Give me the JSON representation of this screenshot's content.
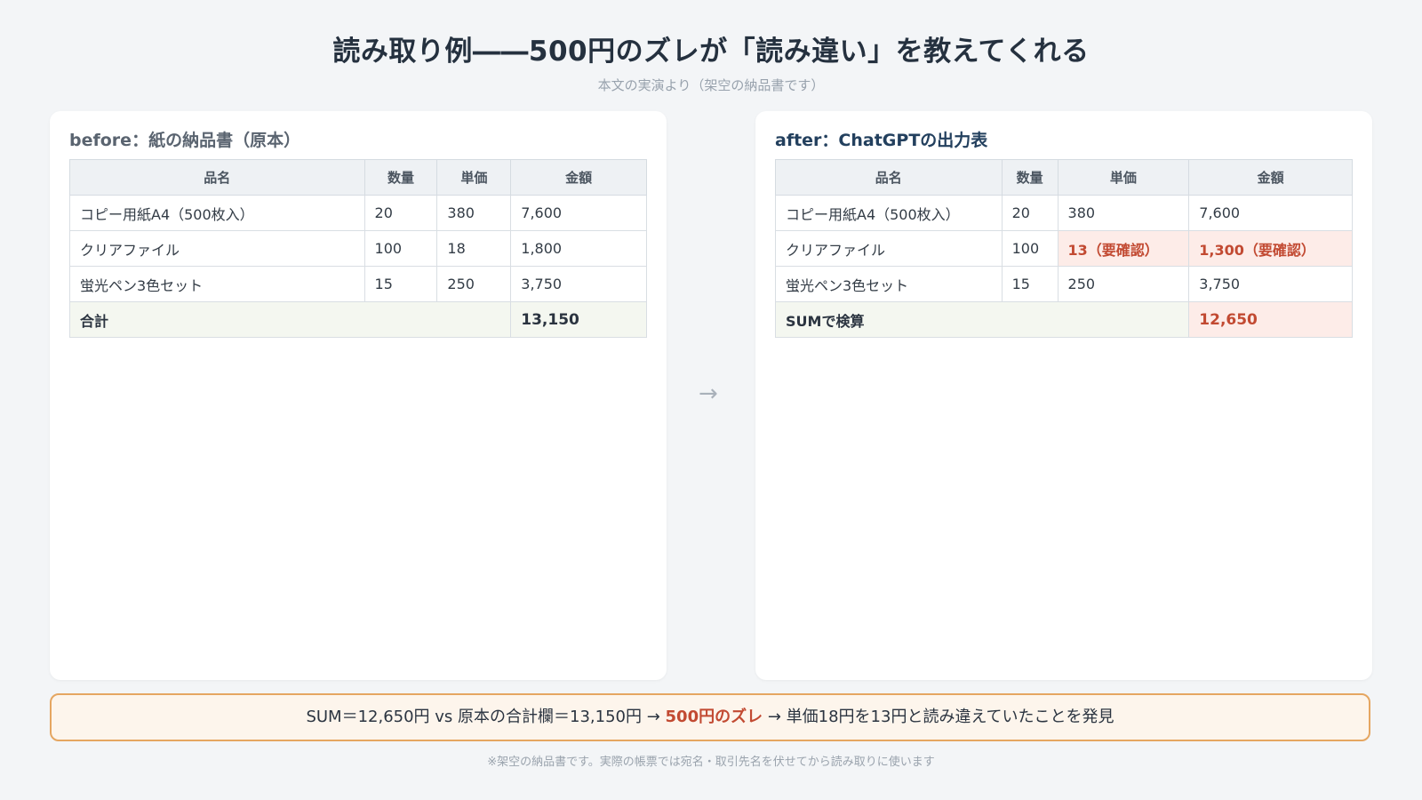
{
  "title": "読み取り例――500円のズレが「読み違い」を教えてくれる",
  "subtitle": "本文の実演より（架空の納品書です）",
  "arrow": "→",
  "before": {
    "panel_title": "before：紙の納品書（原本）",
    "headers": [
      "品名",
      "数量",
      "単価",
      "金額"
    ],
    "rows": [
      {
        "name": "コピー用紙A4（500枚入）",
        "qty": "20",
        "price": "380",
        "amount": "7,600"
      },
      {
        "name": "クリアファイル",
        "qty": "100",
        "price": "18",
        "amount": "1,800"
      },
      {
        "name": "蛍光ペン3色セット",
        "qty": "15",
        "price": "250",
        "amount": "3,750"
      }
    ],
    "total_label": "合計",
    "total_value": "13,150"
  },
  "after": {
    "panel_title": "after：ChatGPTの出力表",
    "headers": [
      "品名",
      "数量",
      "単価",
      "金額"
    ],
    "rows": [
      {
        "name": "コピー用紙A4（500枚入）",
        "qty": "20",
        "price": "380",
        "amount": "7,600"
      },
      {
        "name": "クリアファイル",
        "qty": "100",
        "price": "13（要確認）",
        "amount": "1,300（要確認）"
      },
      {
        "name": "蛍光ペン3色セット",
        "qty": "15",
        "price": "250",
        "amount": "3,750"
      }
    ],
    "total_label": "SUMで検算",
    "total_value": "12,650"
  },
  "summary": {
    "prefix": "SUM＝12,650円 vs 原本の合計欄＝13,150円 → ",
    "highlight": "500円のズレ",
    "suffix": " → 単価18円を13円と読み違えていたことを発見"
  },
  "footnote": "※架空の納品書です。実際の帳票では宛名・取引先名を伏せてから読み取りに使います",
  "colors": {
    "background": "#f3f5f7",
    "flag_text": "#c24a32",
    "flag_bg": "#fdece8",
    "summary_border": "#e5a661",
    "summary_bg": "#fdf5ec"
  }
}
